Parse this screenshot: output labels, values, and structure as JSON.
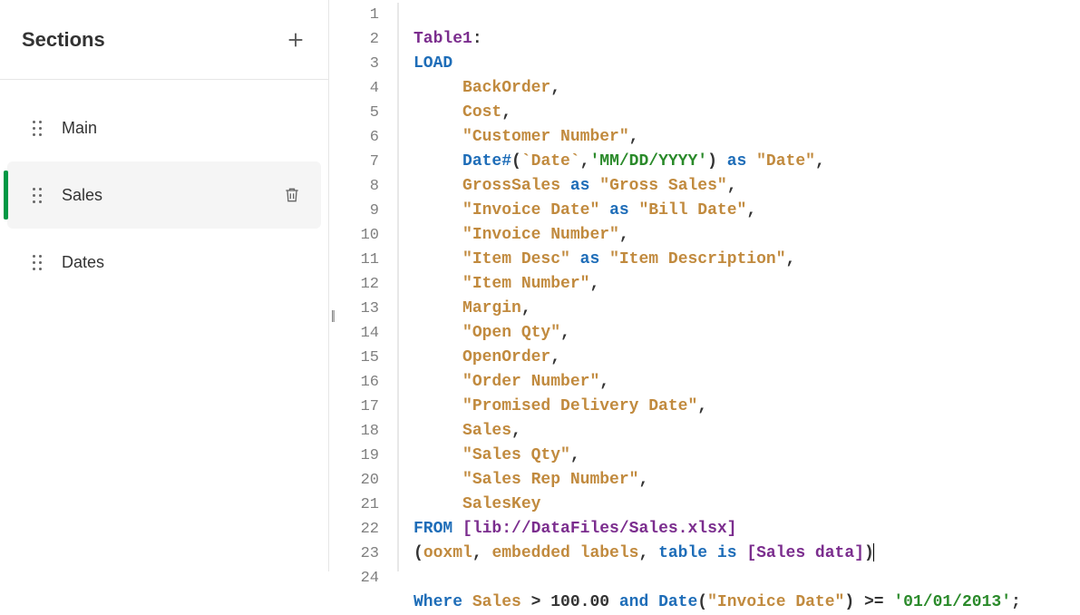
{
  "sidebar": {
    "title": "Sections",
    "items": [
      {
        "label": "Main",
        "selected": false
      },
      {
        "label": "Sales",
        "selected": true
      },
      {
        "label": "Dates",
        "selected": false
      }
    ]
  },
  "editor": {
    "line_count": 24,
    "tokens": {
      "l1_table": "Table1",
      "l2_load": "LOAD",
      "l3_field": "BackOrder",
      "l4_field": "Cost",
      "l5_str": "\"Customer Number\"",
      "l6_func": "Date#",
      "l6_arg1": "`Date`",
      "l6_arg2": "'MM/DD/YYYY'",
      "l6_as": "as",
      "l6_alias": "\"Date\"",
      "l7_field": "GrossSales",
      "l7_as": "as",
      "l7_alias": "\"Gross Sales\"",
      "l8_str": "\"Invoice Date\"",
      "l8_as": "as",
      "l8_alias": "\"Bill Date\"",
      "l9_str": "\"Invoice Number\"",
      "l10_str": "\"Item Desc\"",
      "l10_as": "as",
      "l10_alias": "\"Item Description\"",
      "l11_str": "\"Item Number\"",
      "l12_field": "Margin",
      "l13_str": "\"Open Qty\"",
      "l14_field": "OpenOrder",
      "l15_str": "\"Order Number\"",
      "l16_str": "\"Promised Delivery Date\"",
      "l17_field": "Sales",
      "l18_str": "\"Sales Qty\"",
      "l19_str": "\"Sales Rep Number\"",
      "l20_field": "SalesKey",
      "l21_from": "FROM",
      "l21_path": "[lib://DataFiles/Sales.xlsx]",
      "l22_open": "(",
      "l22_ooxml": "ooxml",
      "l22_comma1": ", ",
      "l22_embed": "embedded labels",
      "l22_comma2": ", ",
      "l22_tableis": "table is",
      "l22_tablename": "[Sales data]",
      "l22_close": ")",
      "l24_where": "Where",
      "l24_sales": "Sales",
      "l24_gt": " > ",
      "l24_num": "100.00",
      "l24_and": " and ",
      "l24_datefn": "Date",
      "l24_open": "(",
      "l24_arg": "\"Invoice Date\"",
      "l24_close": ")",
      "l24_gte": " >= ",
      "l24_datestr": "'01/01/2013'",
      "l24_semi": ";"
    }
  }
}
